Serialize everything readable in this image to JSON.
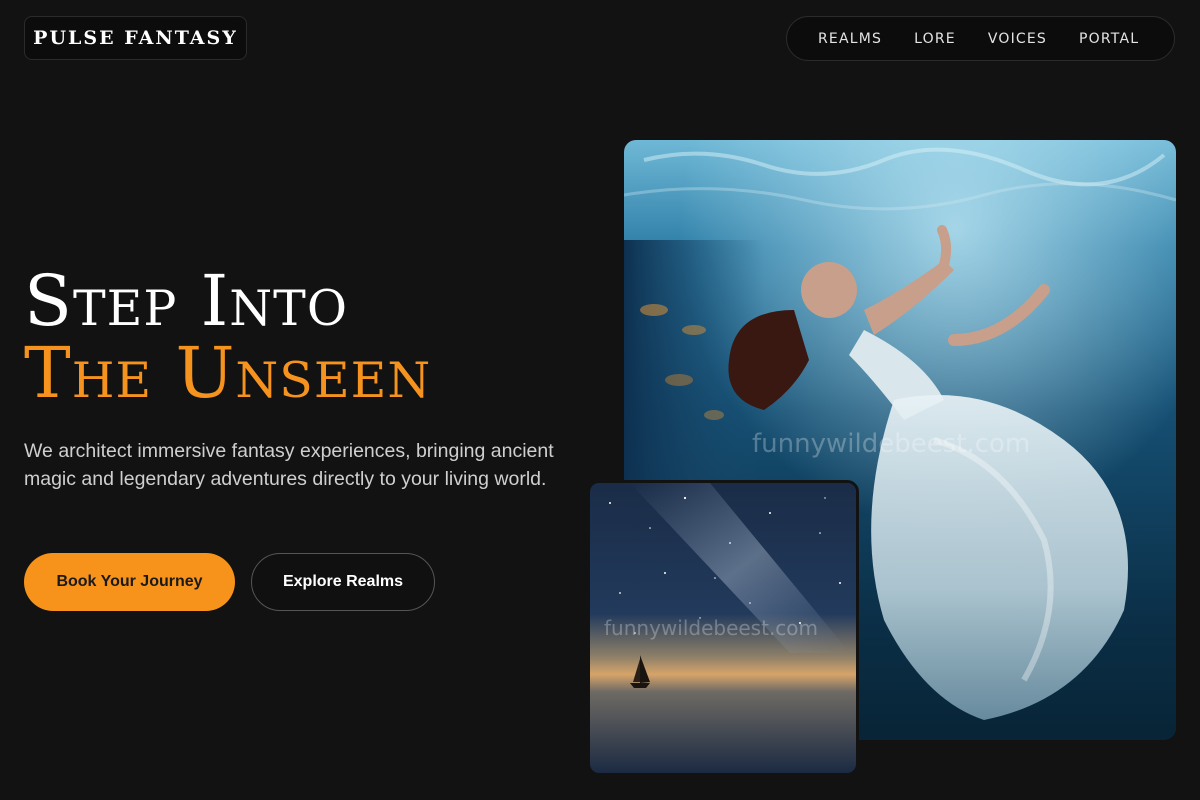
{
  "header": {
    "logo": "PULSE FANTASY",
    "nav": [
      "REALMS",
      "LORE",
      "VOICES",
      "PORTAL"
    ]
  },
  "hero": {
    "title_line1": "Step Into",
    "title_line2": "The Unseen",
    "description": "We architect immersive fantasy experiences, bringing ancient magic and legendary adventures directly to your living world.",
    "primary_button": "Book Your Journey",
    "secondary_button": "Explore Realms"
  },
  "images": {
    "main_watermark": "funnywildebeest.com",
    "small_watermark": "funnywildebeest.com"
  },
  "colors": {
    "background": "#121212",
    "accent": "#f7931a",
    "text": "#ffffff"
  }
}
